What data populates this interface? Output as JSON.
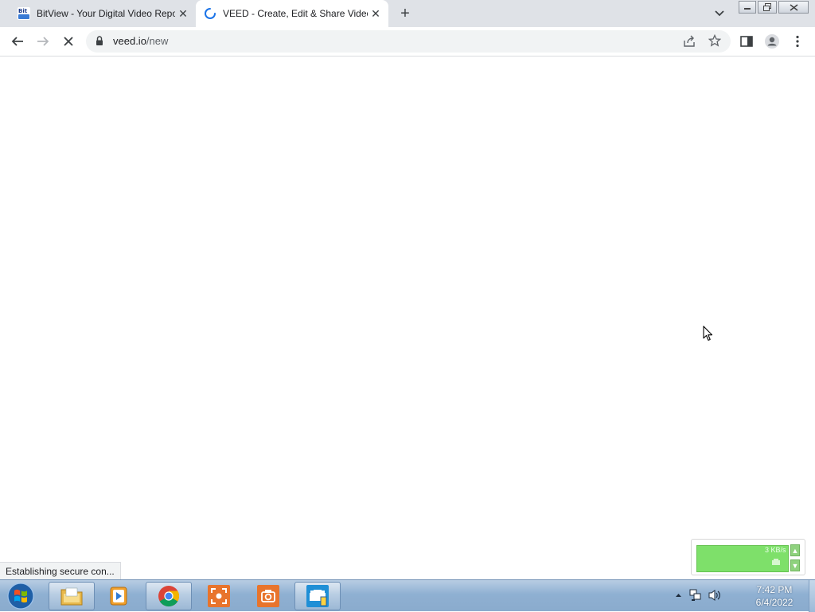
{
  "browser": {
    "tabs": [
      {
        "title": "BitView - Your Digital Video Repository",
        "favicon": "bitview-icon",
        "active": false
      },
      {
        "title": "VEED - Create, Edit & Share Videos Online",
        "favicon": "loading-spinner-icon",
        "active": true
      }
    ],
    "address": {
      "host": "veed.io",
      "path": "/new"
    },
    "status_text": "Establishing secure con..."
  },
  "network_widget": {
    "speed": "3 KB/s"
  },
  "taskbar": {
    "apps": [
      {
        "name": "file-explorer",
        "icon": "folder-icon"
      },
      {
        "name": "media-player",
        "icon": "media-player-icon"
      },
      {
        "name": "chrome",
        "icon": "chrome-icon"
      },
      {
        "name": "screenshot-tool",
        "icon": "screenshot-icon"
      },
      {
        "name": "camera-tool",
        "icon": "camera-icon"
      },
      {
        "name": "screen-recorder",
        "icon": "screen-recorder-icon"
      }
    ],
    "clock": {
      "time": "7:42 PM",
      "date": "6/4/2022"
    }
  },
  "colors": {
    "tabstrip": "#dfe2e7",
    "omnibox": "#f1f3f4",
    "taskbar": "#8fb0d2",
    "net_bar": "#7ee06a",
    "spinner": "#1a73e8"
  }
}
